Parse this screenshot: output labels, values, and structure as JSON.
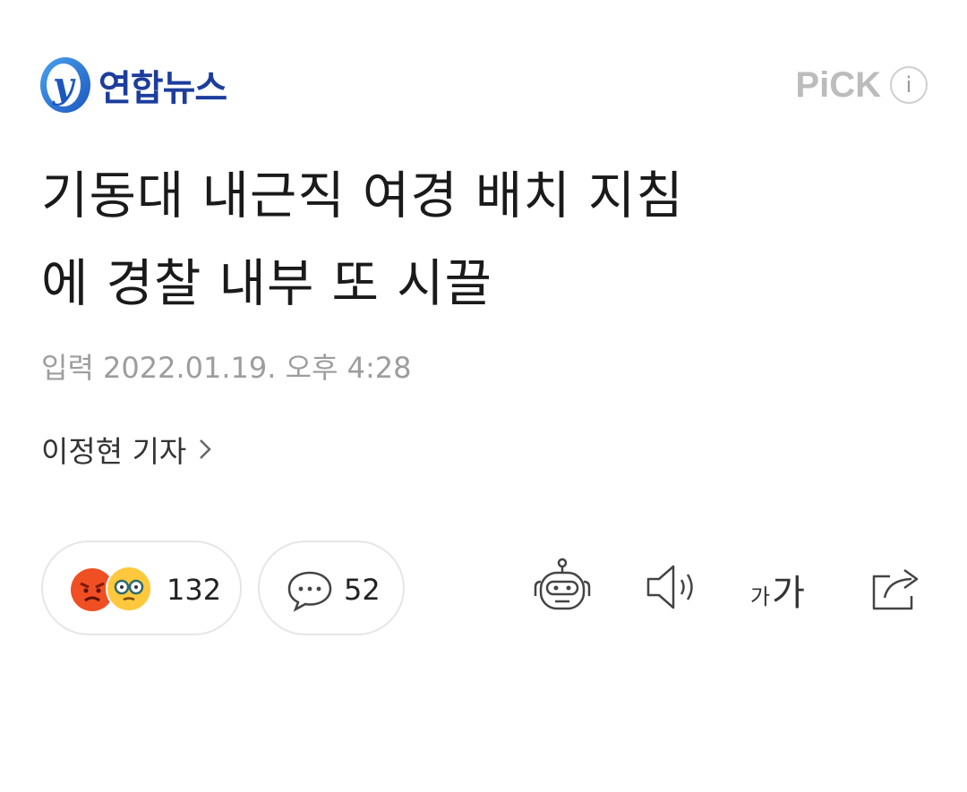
{
  "header": {
    "publisher": "연합뉴스",
    "pick_label": "PiCK",
    "info_symbol": "i"
  },
  "article": {
    "title_line1": "기동대 내근직 여경 배치 지침",
    "title_line2": "에 경찰 내부 또 시끌",
    "date": "입력 2022.01.19. 오후 4:28",
    "reporter": "이정현 기자"
  },
  "reactions": {
    "count": "132",
    "icons": [
      "angry-face-icon",
      "nerd-face-icon"
    ]
  },
  "comments": {
    "count": "52"
  },
  "tools": {
    "font_small": "가",
    "font_big": "가",
    "icons": [
      "summary-bot-icon",
      "speaker-icon",
      "font-size-icon",
      "share-icon"
    ]
  },
  "colors": {
    "brand": "#1c3d9c",
    "brand_light": "#2f7fd8",
    "muted": "#9d9d9d",
    "angry": "#f04e23",
    "nerd": "#ffc83d"
  }
}
